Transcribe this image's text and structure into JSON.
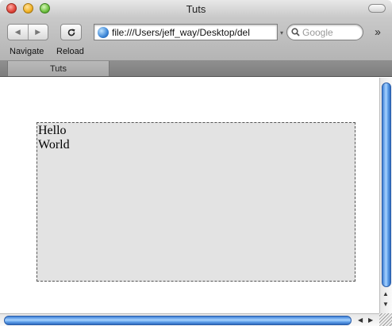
{
  "window": {
    "title": "Tuts"
  },
  "toolbar": {
    "navigate_label": "Navigate",
    "reload_label": "Reload",
    "back_icon": "left-triangle-icon",
    "forward_icon": "right-triangle-icon",
    "reload_icon": "reload-icon"
  },
  "address": {
    "url": "file:///Users/jeff_way/Desktop/del"
  },
  "search": {
    "placeholder": "Google"
  },
  "tabs": [
    {
      "label": "Tuts"
    }
  ],
  "page": {
    "lines": [
      "Hello",
      "World"
    ]
  },
  "colors": {
    "box_background": "#e3e3e3",
    "scroll_thumb": "#5d9ee8"
  }
}
